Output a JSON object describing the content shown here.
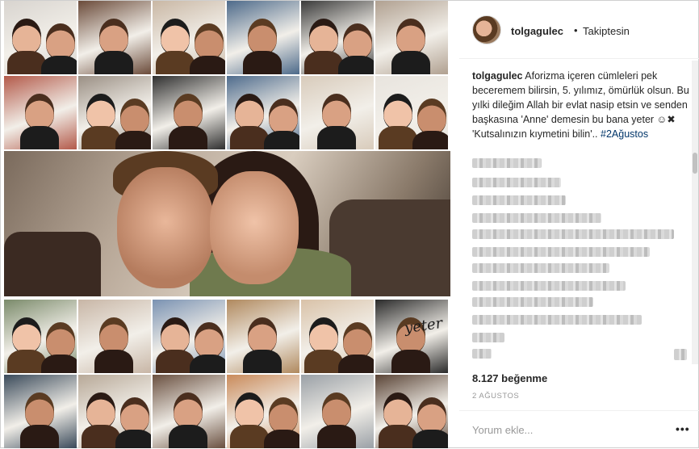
{
  "post": {
    "username": "tolgagulec",
    "dot": "•",
    "follow_status": "Takiptesin",
    "caption_user": "tolgagulec",
    "caption_text": " Aforizma içeren cümleleri pek beceremem bilirsin, 5. yılımız, ömürlük olsun. Bu yılki dileğim Allah bir evlat nasip etsin ve senden başkasına 'Anne' demesin bu bana yeter ☺✖ 'Kutsalınızın kıymetini bilin'.. ",
    "hashtag": "#2Ağustos",
    "likes": "8.127 beğenme",
    "date": "2 AĞUSTOS",
    "comment_placeholder": "Yorum ekle...",
    "more_label": "•••"
  },
  "collage": {
    "tile_colors": [
      [
        "#d8d4cf",
        "#6b4b3a",
        "#c9b7a4",
        "#4d6a8a",
        "#3a3a3a",
        "#b0a090"
      ],
      [
        "#b35a4a",
        "#9a8f84",
        "#2f2f2f",
        "#4e6b8c",
        "#d8cbbb",
        "#e8e4de"
      ],
      [
        "#7a8a6a",
        "#c8b6a6",
        "#7a92b2",
        "#b0895e",
        "#d9c2a8",
        "#2a2a2a"
      ],
      [
        "#3a4a5a",
        "#b7a897",
        "#6a5040",
        "#c98a5a",
        "#9aa0a6",
        "#5a4436"
      ]
    ],
    "overlay_text": "yeter"
  }
}
